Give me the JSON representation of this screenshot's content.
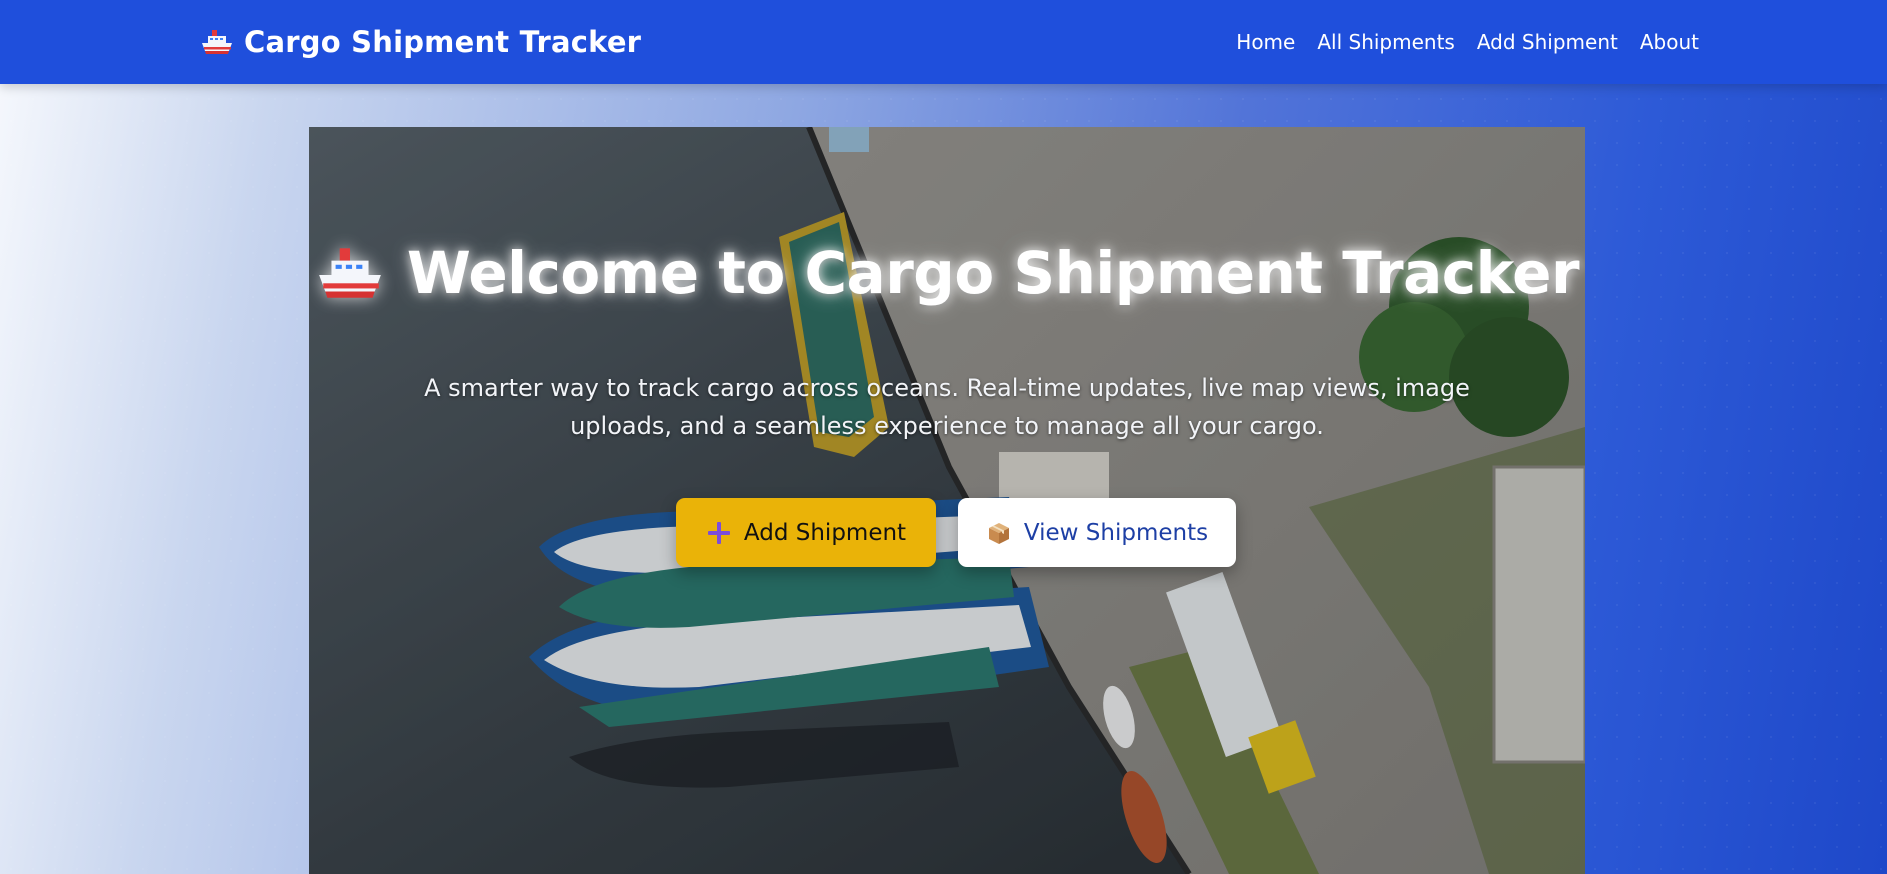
{
  "header": {
    "brand_title": "Cargo Shipment Tracker",
    "brand_icon": "cruise-ship-icon",
    "nav": [
      {
        "label": "Home"
      },
      {
        "label": "All Shipments"
      },
      {
        "label": "Add Shipment"
      },
      {
        "label": "About"
      }
    ]
  },
  "hero": {
    "title": "Welcome to Cargo Shipment Tracker",
    "title_icon": "cruise-ship-icon",
    "subtitle": "A smarter way to track cargo across oceans. Real-time updates, live map views, image uploads, and a seamless experience to manage all your cargo.",
    "primary_button": {
      "label": "Add Shipment",
      "icon": "plus-icon"
    },
    "secondary_button": {
      "label": "View Shipments",
      "icon": "package-icon"
    }
  },
  "colors": {
    "navbar": "#1f4fdc",
    "primary_button": "#eab308",
    "secondary_button_text": "#1d3fa5"
  }
}
